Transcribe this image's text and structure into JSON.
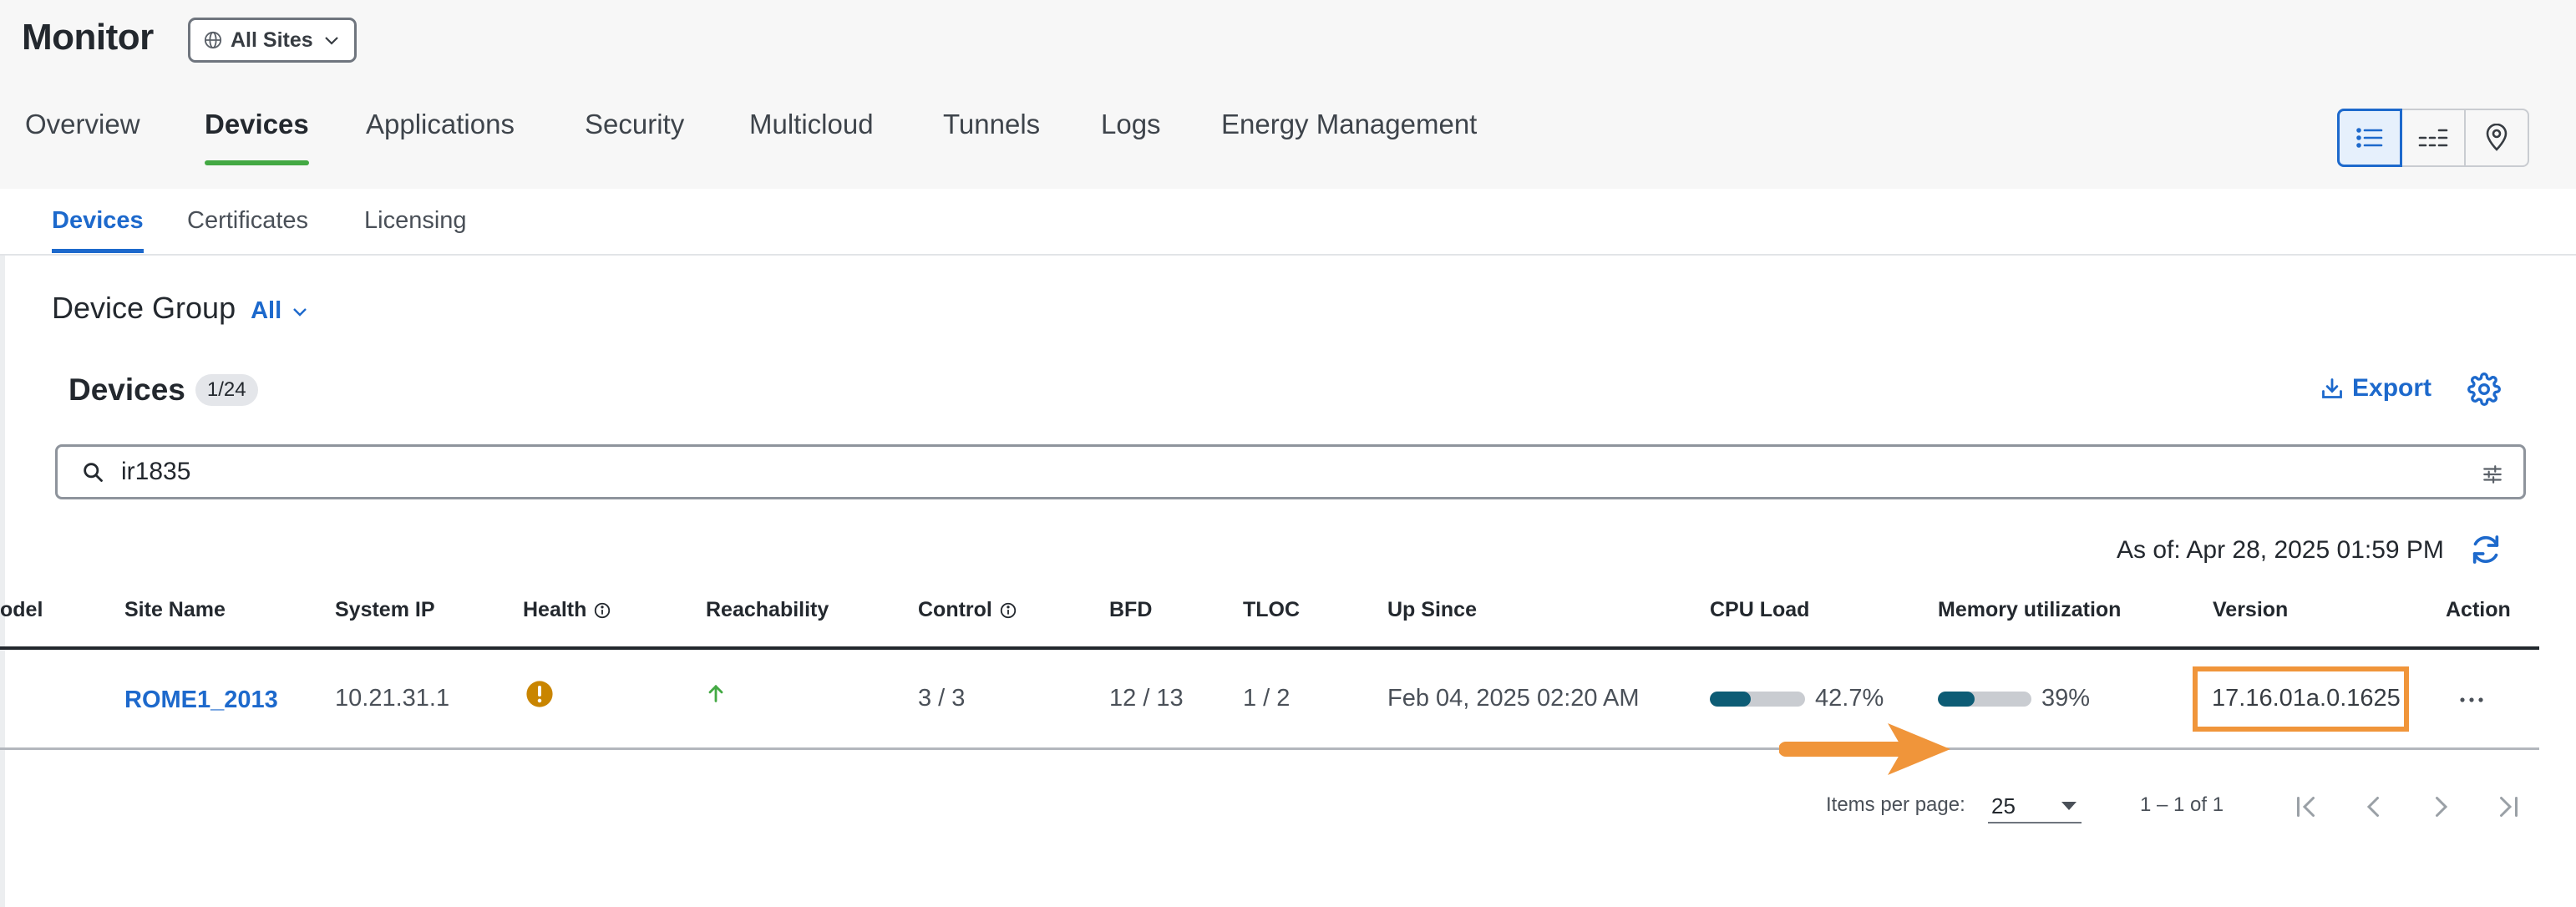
{
  "header": {
    "title": "Monitor",
    "site_selector": "All Sites"
  },
  "main_tabs": [
    {
      "label": "Overview"
    },
    {
      "label": "Devices"
    },
    {
      "label": "Applications"
    },
    {
      "label": "Security"
    },
    {
      "label": "Multicloud"
    },
    {
      "label": "Tunnels"
    },
    {
      "label": "Logs"
    },
    {
      "label": "Energy Management"
    }
  ],
  "active_main_tab": "Devices",
  "view_modes": [
    "list-icon",
    "table-icon",
    "map-pin-icon"
  ],
  "sub_tabs": [
    {
      "label": "Devices"
    },
    {
      "label": "Certificates"
    },
    {
      "label": "Licensing"
    }
  ],
  "device_group": {
    "label": "Device Group",
    "value": "All"
  },
  "devices_section": {
    "title": "Devices",
    "count": "1/24",
    "export_label": "Export"
  },
  "search": {
    "value": "ir1835"
  },
  "as_of": "As of: Apr 28, 2025 01:59 PM",
  "table": {
    "columns": [
      "odel",
      "Site Name",
      "System IP",
      "Health",
      "Reachability",
      "Control",
      "BFD",
      "TLOC",
      "Up Since",
      "CPU Load",
      "Memory utilization",
      "Version",
      "Action"
    ],
    "rows": [
      {
        "site_name": "ROME1_2013",
        "system_ip": "10.21.31.1",
        "health": "warning",
        "reachability": "up",
        "control": "3 / 3",
        "bfd": "12 / 13",
        "tloc": "1 / 2",
        "up_since": "Feb 04, 2025 02:20 AM",
        "cpu_load": "42.7%",
        "cpu_fraction": 0.427,
        "memory": "39%",
        "memory_fraction": 0.39,
        "version": "17.16.01a.0.1625"
      }
    ]
  },
  "pagination": {
    "items_per_page_label": "Items per page:",
    "items_per_page": "25",
    "range": "1 – 1 of 1"
  },
  "colors": {
    "accent_blue": "#1d69cc",
    "active_tab_green": "#43a943",
    "highlight_orange": "#f0953a",
    "warning_orange": "#c98500",
    "bar_fill": "#0d5c75"
  }
}
